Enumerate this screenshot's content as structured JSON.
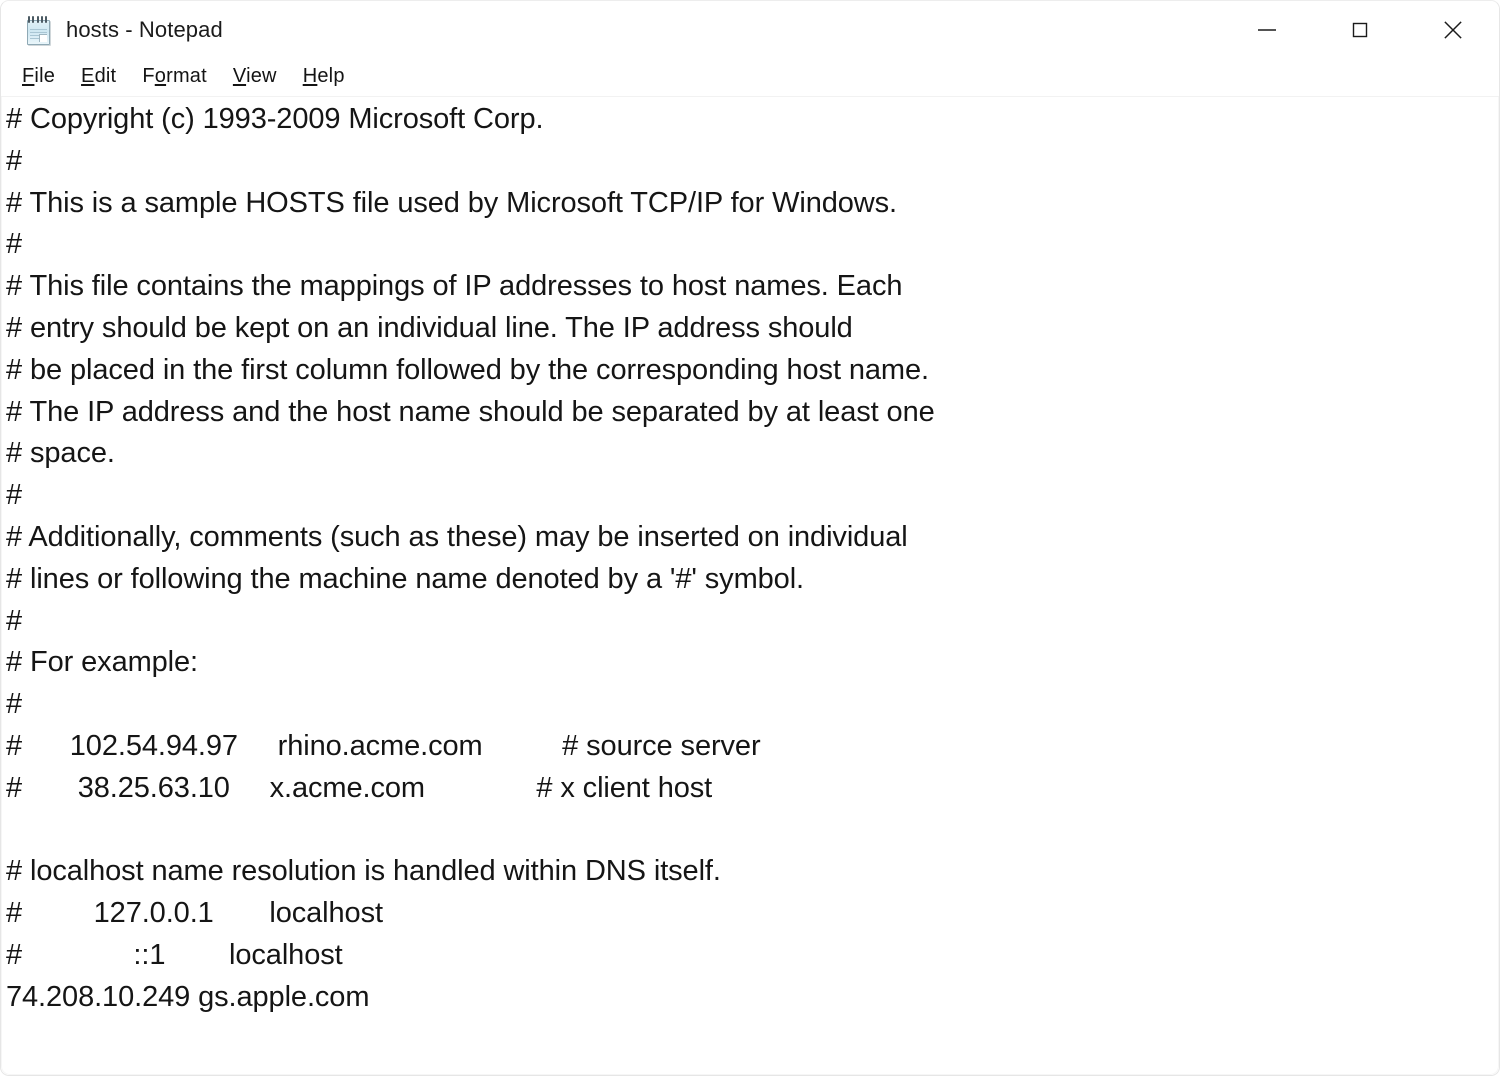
{
  "window": {
    "title": "hosts - Notepad",
    "icon": "notepad-icon",
    "background_color": "#ffffff",
    "text_color": "#151515"
  },
  "window_controls": [
    {
      "name": "minimize-button",
      "icon": "minimize-icon",
      "label": "Minimize"
    },
    {
      "name": "maximize-button",
      "icon": "maximize-icon",
      "label": "Maximize"
    },
    {
      "name": "close-button",
      "icon": "close-icon",
      "label": "Close"
    }
  ],
  "menubar": {
    "items": [
      {
        "label": "File",
        "mnemonic": "F",
        "rest": "ile"
      },
      {
        "label": "Edit",
        "mnemonic": "E",
        "rest": "dit"
      },
      {
        "label": "Format",
        "mnemonic": "o",
        "pre": "F",
        "rest": "rmat"
      },
      {
        "label": "View",
        "mnemonic": "V",
        "rest": "iew"
      },
      {
        "label": "Help",
        "mnemonic": "H",
        "rest": "elp"
      }
    ]
  },
  "editor": {
    "filename": "hosts",
    "content": "# Copyright (c) 1993-2009 Microsoft Corp.\n#\n# This is a sample HOSTS file used by Microsoft TCP/IP for Windows.\n#\n# This file contains the mappings of IP addresses to host names. Each\n# entry should be kept on an individual line. The IP address should\n# be placed in the first column followed by the corresponding host name.\n# The IP address and the host name should be separated by at least one\n# space.\n#\n# Additionally, comments (such as these) may be inserted on individual\n# lines or following the machine name denoted by a '#' symbol.\n#\n# For example:\n#\n#      102.54.94.97     rhino.acme.com          # source server\n#       38.25.63.10     x.acme.com              # x client host\n\n# localhost name resolution is handled within DNS itself.\n#         127.0.0.1       localhost\n#              ::1        localhost\n74.208.10.249 gs.apple.com",
    "lines": [
      "# Copyright (c) 1993-2009 Microsoft Corp.",
      "#",
      "# This is a sample HOSTS file used by Microsoft TCP/IP for Windows.",
      "#",
      "# This file contains the mappings of IP addresses to host names. Each",
      "# entry should be kept on an individual line. The IP address should",
      "# be placed in the first column followed by the corresponding host name.",
      "# The IP address and the host name should be separated by at least one",
      "# space.",
      "#",
      "# Additionally, comments (such as these) may be inserted on individual",
      "# lines or following the machine name denoted by a '#' symbol.",
      "#",
      "# For example:",
      "#",
      "#      102.54.94.97     rhino.acme.com          # source server",
      "#       38.25.63.10     x.acme.com              # x client host",
      "",
      "# localhost name resolution is handled within DNS itself.",
      "#         127.0.0.1       localhost",
      "#              ::1        localhost",
      "74.208.10.249 gs.apple.com"
    ],
    "host_entries": [
      {
        "ip": "102.54.94.97",
        "host": "rhino.acme.com",
        "comment": "# source server",
        "commented_out": true
      },
      {
        "ip": "38.25.63.10",
        "host": "x.acme.com",
        "comment": "# x client host",
        "commented_out": true
      },
      {
        "ip": "127.0.0.1",
        "host": "localhost",
        "comment": "",
        "commented_out": true
      },
      {
        "ip": "::1",
        "host": "localhost",
        "comment": "",
        "commented_out": true
      },
      {
        "ip": "74.208.10.249",
        "host": "gs.apple.com",
        "comment": "",
        "commented_out": false
      }
    ]
  }
}
